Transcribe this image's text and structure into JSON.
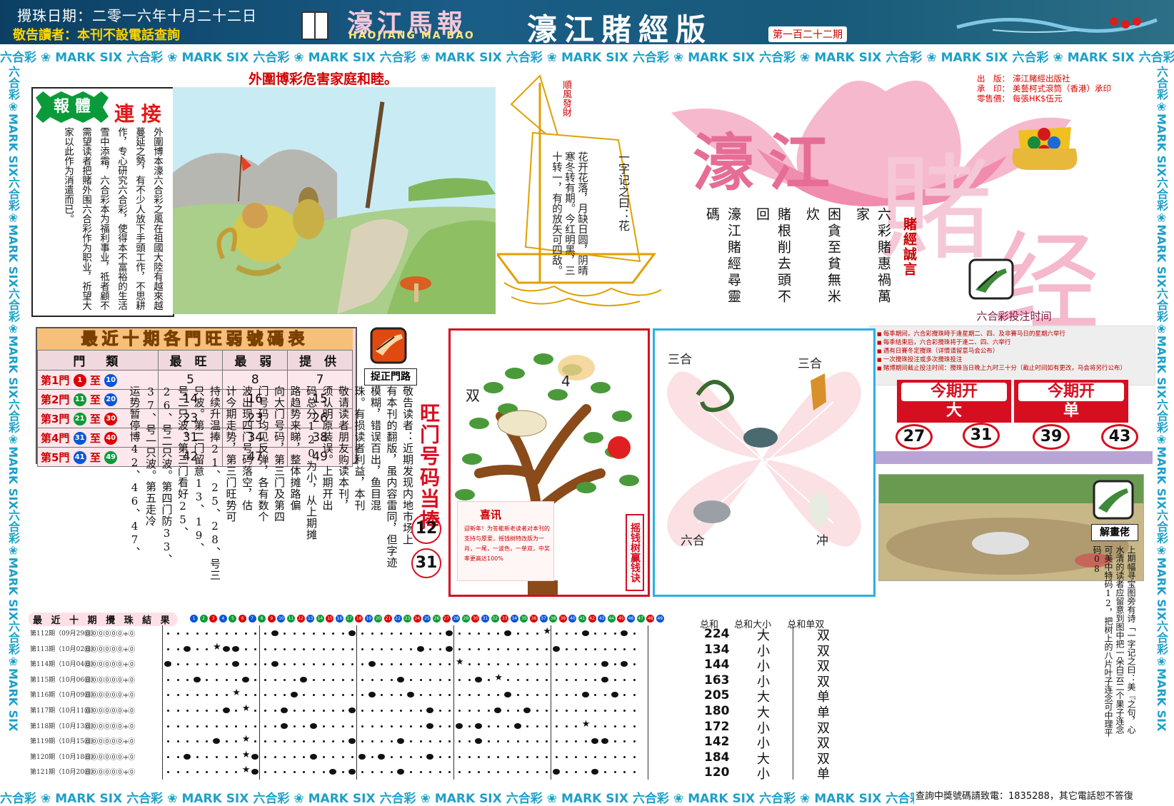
{
  "header": {
    "date": "攪珠日期：二零一六年十月二十二日",
    "notice": "敬告讀者：本刊不設電話查詢",
    "title_cn": "濠江馬報",
    "title_en": "HAOJIANG MA BAO",
    "edition": "濠江賭經版",
    "issue": "第一百二十二期",
    "bg_color": "#0c3f63"
  },
  "strip": {
    "liuhecai": "六合彩",
    "marksix": "MARK SIX",
    "accent": "#1ea0c8"
  },
  "hazard": {
    "title": "外圍博彩危害家庭和睦。"
  },
  "story": {
    "tag1": "報 體",
    "tag2": "連 接",
    "text": "外圍博本濠六合彩之風在祖國大陸有越來越蔓延之勢，有不少人放下手頭工作，不思耕作，专心研究六合彩，使得本不富裕的生活雪中添霜，六合彩本为福利事业，祗者顧不需望读者把賭外围六合彩作为职业，祈望大家以此作为消遣而已。"
  },
  "ship": {
    "flag": "順風發財",
    "text1": "一字记之曰：花",
    "text2": "花开花落，月缺日圆，阴晴寒冬转有期。今红明黑，三十转一，有的放矢可四敌。"
  },
  "publication": {
    "publisher_k": "出　版：",
    "publisher_v": "濠江賭經出版社",
    "printer_k": "承　印：",
    "printer_v": "美藝柯式滾筒（香港）承印",
    "price_k": "零售價：",
    "price_v": "每張HK$伍元"
  },
  "logo": {
    "word1": "濠江",
    "word2": "賭",
    "word3": "经"
  },
  "poem": {
    "col1": "六彩賭惠禍萬家",
    "col2": "困貪至貧無米炊",
    "col3": "賭根削去頭不回",
    "col4": "濠江賭經尋靈碼",
    "sign": "賭經誠言"
  },
  "betting": {
    "title": "六合彩投注时间",
    "items": [
      "每季期间，六合彩攪珠時于逢星期二、四、及非賽马日的星期六举行",
      "每季结束后，六合彩攪珠将于逢二、四、六举行",
      "遇有日賽冬定攪珠（详情请留意马会公布）",
      "一次攪珠投注或多次攪珠投注",
      "賭博期间截止投注时间：攪珠当日晚上九时三十分（截止时间如有更改，马会将另行公布）"
    ]
  },
  "this_period": {
    "head": "今期开",
    "left": "大",
    "right": "单",
    "balls": [
      "27",
      "31",
      "39",
      "43"
    ]
  },
  "table": {
    "title": "最近十期各門旺弱號碼表",
    "headers": [
      "門　類",
      "最 旺",
      "最 弱",
      "提 供"
    ],
    "rows": [
      {
        "door": "第1門",
        "from": "1",
        "to": "10",
        "best": "5",
        "worst": "8",
        "tip": "7"
      },
      {
        "door": "第2門",
        "from": "11",
        "to": "20",
        "best": "14",
        "worst": "16",
        "tip": "15"
      },
      {
        "door": "第3門",
        "from": "21",
        "to": "30",
        "best": "23",
        "worst": "23",
        "tip": "26"
      },
      {
        "door": "第4門",
        "from": "31",
        "to": "40",
        "best": "31",
        "worst": "34",
        "tip": "38"
      },
      {
        "door": "第5門",
        "from": "41",
        "to": "49",
        "best": "42",
        "worst": "47",
        "tip": "49"
      }
    ],
    "to_word": "至"
  },
  "grab": {
    "label": "捉正門路"
  },
  "article": {
    "cols": [
      "敬告读者：近期发现内地市场上",
      "有本刊的翻版，虽内容雷同，但字迹",
      "模糊，错误百出，鱼目混",
      "珠。有损读者利益，本刊",
      "敬请读者朋友购读本刊，",
      "须认明原装误。上期开出",
      "码总分120为小，从上期摊",
      "路趋势来睇，整体摊路偏",
      "向大门号码，第三门及第四",
      "门号码均见反弹，各有数个",
      "波出现四门号码落空，估",
      "计今期走势，第三门旺势可",
      "持续升温捧21、25、28、号三",
      "只波。第二门留意13、19、",
      "号二只波。第三门看好25、",
      "26、号二只波。第四门防33、",
      "37、号一只波。第五走冷",
      "运势暂停博42、46、47、"
    ]
  },
  "hot": {
    "title": "旺门号码当捧",
    "n1": "12",
    "n2": "31"
  },
  "tree": {
    "tag1": "双",
    "tag2": "4",
    "side": "摇钱树赢钱诀",
    "xi_title": "喜讯",
    "xi_text": "迎新年！为答能新老读者对本刊的支持与厚爱，摇钱树特改版为一肖，一尾，一波色，一单双，中奖率更高达100%"
  },
  "zodiac": {
    "tl": "三合",
    "tr": "三合",
    "bl": "六合",
    "br": "冲"
  },
  "comic": {
    "label": "解畫佬",
    "text": "上期幅寻宝图旁有诗「一字记之曰：美『之句，心水清的读者应留意到图中把一朵白云二个果子连念可美中特码12，把树上的八片叶子连念可中理平码08"
  },
  "results": {
    "title": "最 近 十 期 攪 珠 結 果",
    "sum_head": "总和",
    "bs_head": "总和大小",
    "oe_head": "总和单双",
    "rows": [
      {
        "label": "第112期（09月29日）",
        "sum": "224",
        "bs": "大",
        "oe": "双"
      },
      {
        "label": "第113期（10月02日）",
        "sum": "134",
        "bs": "小",
        "oe": "双"
      },
      {
        "label": "第114期（10月04日）",
        "sum": "144",
        "bs": "小",
        "oe": "双"
      },
      {
        "label": "第115期（10月06日）",
        "sum": "163",
        "bs": "小",
        "oe": "双"
      },
      {
        "label": "第116期（10月09日）",
        "sum": "205",
        "bs": "大",
        "oe": "单"
      },
      {
        "label": "第117期（10月11日）",
        "sum": "180",
        "bs": "大",
        "oe": "单"
      },
      {
        "label": "第118期（10月13日）",
        "sum": "172",
        "bs": "小",
        "oe": "双"
      },
      {
        "label": "第119期（10月15日）",
        "sum": "142",
        "bs": "小",
        "oe": "双"
      },
      {
        "label": "第120期（10月18日）",
        "sum": "184",
        "bs": "大",
        "oe": "双"
      },
      {
        "label": "第121期（10月20日）",
        "sum": "120",
        "bs": "小",
        "oe": "单"
      }
    ],
    "balls_text": "⓪⓪⓪⓪⓪⓪+⓪"
  },
  "footer": {
    "query": "查詢中獎號碼請致電：1835288，其它電話恕不答復"
  }
}
